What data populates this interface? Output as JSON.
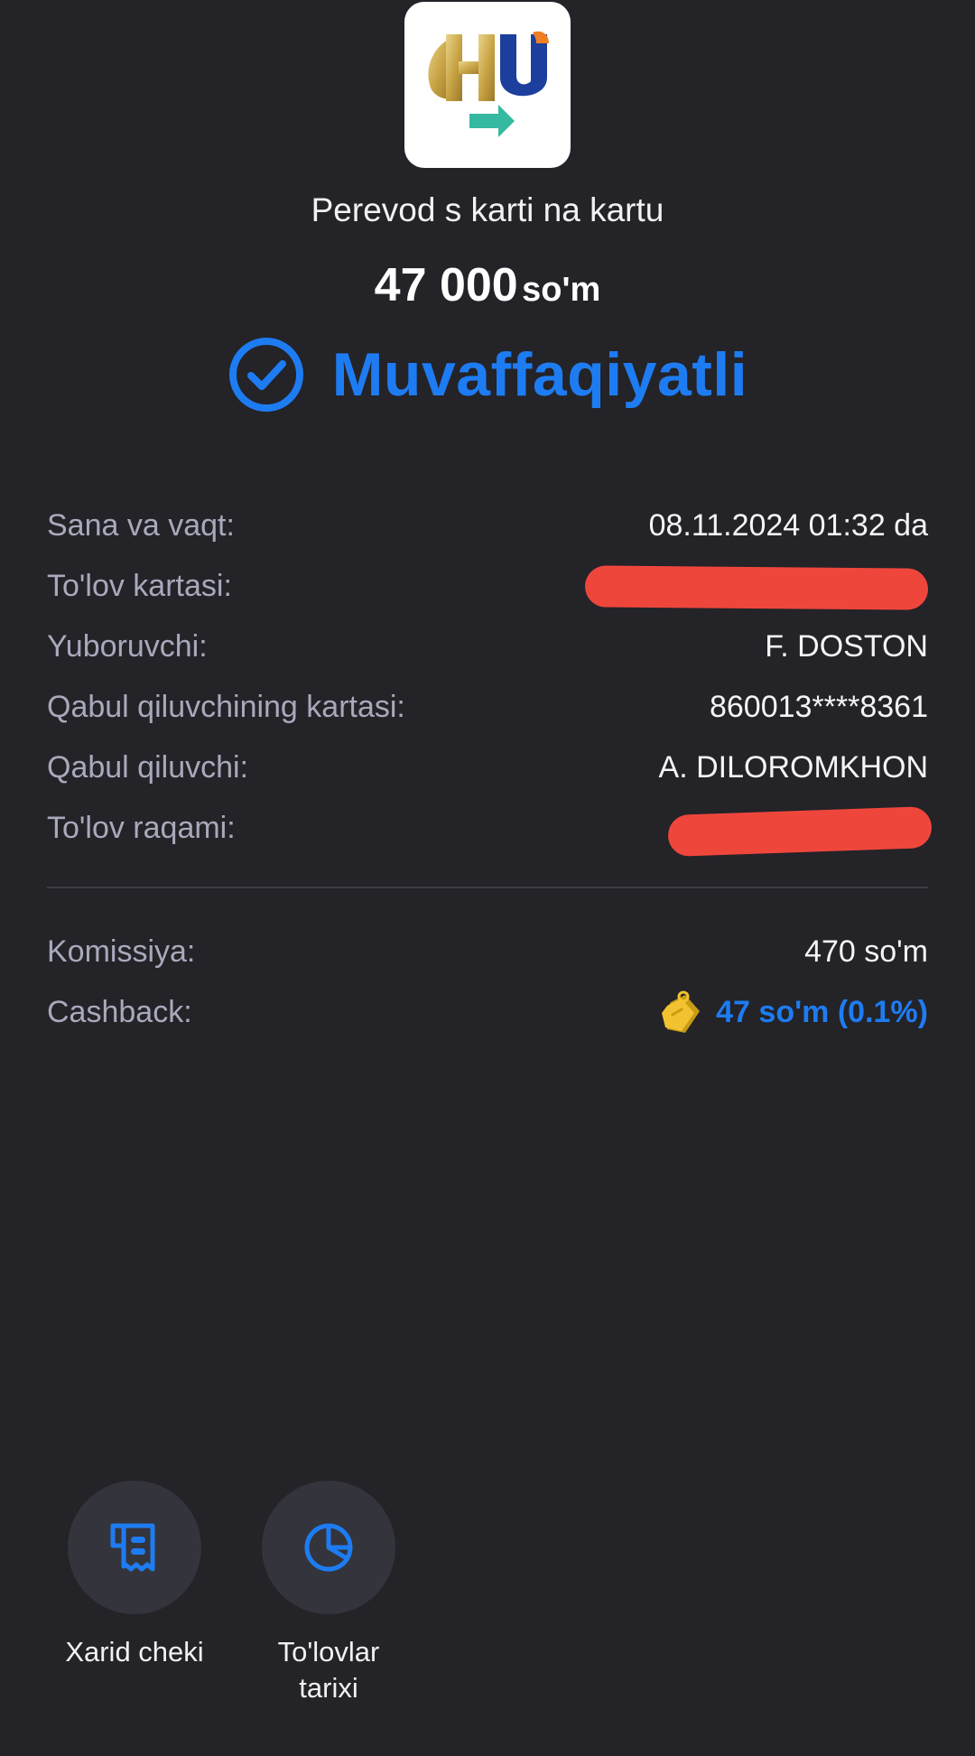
{
  "header": {
    "logo_icon": "humo-uzcard-transfer-logo",
    "title": "Perevod s karti na kartu"
  },
  "amount": {
    "value": "47 000",
    "currency": "so'm"
  },
  "status": {
    "icon": "check-circle-icon",
    "text": "Muvaffaqiyatli",
    "color": "#1e7cf2"
  },
  "details": [
    {
      "label": "Sana va vaqt:",
      "value": "08.11.2024 01:32 da",
      "redacted": false
    },
    {
      "label": "To'lov kartasi:",
      "value": "",
      "redacted": true
    },
    {
      "label": "Yuboruvchi:",
      "value": "F. DOSTON",
      "redacted": false
    },
    {
      "label": "Qabul qiluvchining kartasi:",
      "value": "860013****8361",
      "redacted": false
    },
    {
      "label": "Qabul qiluvchi:",
      "value": "A. DILOROMKHON",
      "redacted": false
    },
    {
      "label": "To'lov raqami:",
      "value": "",
      "redacted": true
    }
  ],
  "fees": {
    "commission_label": "Komissiya:",
    "commission_value": "470 so'm",
    "cashback_label": "Cashback:",
    "cashback_icon": "coin-tag-icon",
    "cashback_value": "47 so'm (0.1%)"
  },
  "actions": [
    {
      "icon": "receipt-icon",
      "label_line1": "Xarid cheki",
      "label_line2": ""
    },
    {
      "icon": "pie-chart-icon",
      "label_line1": "To'lovlar",
      "label_line2": "tarixi"
    }
  ],
  "colors": {
    "background": "#232328",
    "accent": "#1e7cf2",
    "label": "#a9a9bc",
    "redaction": "#ef463c"
  }
}
